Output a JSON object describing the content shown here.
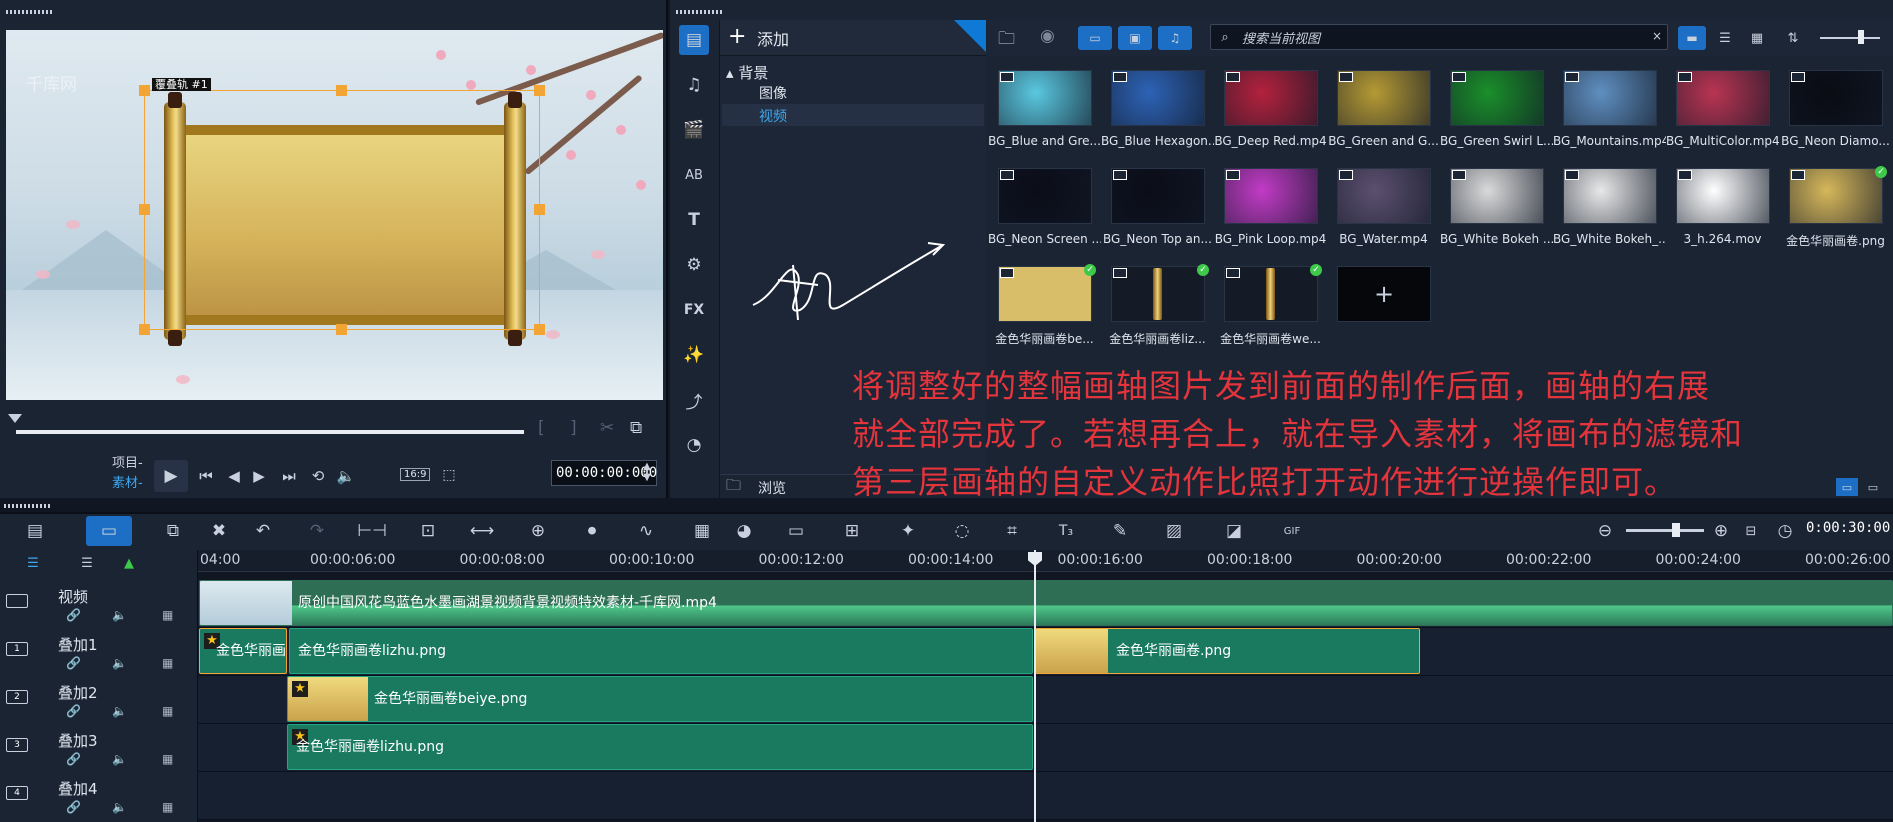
{
  "player": {
    "overlay_label": "覆叠轨 #1",
    "watermark": "千库网",
    "mode_project": "项目-",
    "mode_clip": "素材-",
    "aspect": "16:9",
    "timecode": "00:00:00:000"
  },
  "library": {
    "add_label": "添加",
    "tree_root": "背景",
    "tree_image": "图像",
    "tree_video": "视频",
    "browse_label": "浏览",
    "search_placeholder": "搜索当前视图",
    "items": [
      {
        "caption": "BG_Blue and Gre...",
        "color": "#5ac8e0"
      },
      {
        "caption": "BG_Blue Hexagon...",
        "color": "#2d63b6"
      },
      {
        "caption": "BG_Deep Red.mp4",
        "color": "#b3213d"
      },
      {
        "caption": "BG_Green and G...",
        "color": "#b59a34"
      },
      {
        "caption": "BG_Green Swirl L...",
        "color": "#1a8f2a"
      },
      {
        "caption": "BG_Mountains.mp4",
        "color": "#5f8fc0"
      },
      {
        "caption": "BG_MultiColor.mp4",
        "color": "#b93452"
      },
      {
        "caption": "BG_Neon Diamo...",
        "color": "#0a0c14"
      },
      {
        "caption": "BG_Neon Screen ...",
        "color": "#0b0d18"
      },
      {
        "caption": "BG_Neon Top an...",
        "color": "#0b0d18"
      },
      {
        "caption": "BG_Pink Loop.mp4",
        "color": "#c23bc6"
      },
      {
        "caption": "BG_Water.mp4",
        "color": "#5c5070"
      },
      {
        "caption": "BG_White Bokeh ...",
        "color": "#dadada"
      },
      {
        "caption": "BG_White Bokeh_...",
        "color": "#e8e8e8"
      },
      {
        "caption": "3_h.264.mov",
        "color": "#ffffff"
      },
      {
        "caption": "金色华丽画卷.png",
        "color": "#d6b75a"
      },
      {
        "caption": "金色华丽画卷be...",
        "color": "#d8be68"
      },
      {
        "caption": "金色华丽画卷liz...",
        "color": "#151b26"
      },
      {
        "caption": "金色华丽画卷we...",
        "color": "#151b26"
      }
    ],
    "add_tile": "+"
  },
  "annotation": {
    "line1": "将调整好的整幅画轴图片发到前面的制作后面，画轴的右展",
    "line2": "就全部完成了。若想再合上，就在导入素材，将画布的滤镜和",
    "line3": "第三层画轴的自定义动作比照打开动作进行逆操作即可。"
  },
  "timeline": {
    "time": "0:00:30:00",
    "ruler": [
      "04:00",
      "00:00:06:00",
      "00:00:08:00",
      "00:00:10:00",
      "00:00:12:00",
      "00:00:14:00",
      "00:00:16:00",
      "00:00:18:00",
      "00:00:20:00",
      "00:00:22:00",
      "00:00:24:00",
      "00:00:26:00"
    ],
    "tracks": [
      {
        "name": "视频",
        "num": ""
      },
      {
        "name": "叠加1",
        "num": "1"
      },
      {
        "name": "叠加2",
        "num": "2"
      },
      {
        "name": "叠加3",
        "num": "3"
      },
      {
        "name": "叠加4",
        "num": "4"
      }
    ],
    "clips": {
      "video": "原创中国风花鸟蓝色水墨画湖景视频背景视频特效素材-千库网.mp4",
      "ov1_a": "金色华丽画",
      "ov1_b": "金色华丽画卷lizhu.png",
      "ov1_c": "金色华丽画卷.png",
      "ov2": "金色华丽画卷beiye.png",
      "ov3": "金色华丽画卷lizhu.png"
    }
  }
}
